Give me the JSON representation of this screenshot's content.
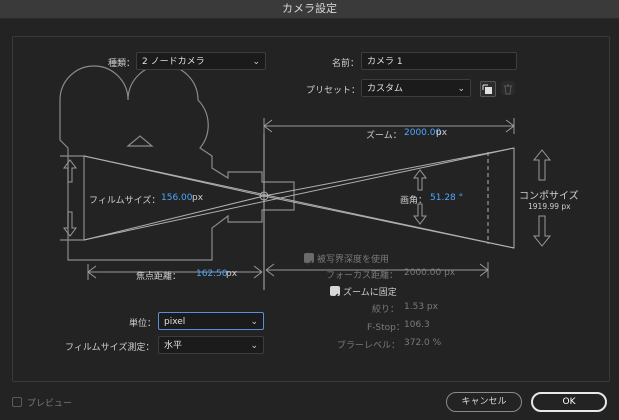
{
  "window": {
    "title": "カメラ設定"
  },
  "type": {
    "label": "種類：",
    "value": "2 ノードカメラ"
  },
  "name": {
    "label": "名前：",
    "value": "カメラ 1"
  },
  "preset": {
    "label": "プリセット：",
    "value": "カスタム"
  },
  "icons": {
    "save": "save-preset-icon",
    "delete": "trash-icon",
    "chevron": "chevron-down-icon",
    "checkmark": "checkmark-icon"
  },
  "zoom": {
    "label": "ズーム：",
    "value": "2000.00",
    "unit": "px"
  },
  "film_size": {
    "label": "フィルムサイズ：",
    "value": "156.00",
    "unit": "px"
  },
  "angle": {
    "label": "画角：",
    "value": "51.28 °"
  },
  "comp_size": {
    "label": "コンポサイズ",
    "value": "1919.99 px"
  },
  "focal_length": {
    "label": "焦点距離：",
    "value": "162.50",
    "unit": "px"
  },
  "dof": {
    "label": "被写界深度を使用",
    "checked": true,
    "enabled": false
  },
  "focus_distance": {
    "label": "フォーカス距離：",
    "value": "2000.00 px"
  },
  "lock_zoom": {
    "label": "ズームに固定",
    "checked": true
  },
  "aperture": {
    "label": "絞り：",
    "value": "1.53 px"
  },
  "fstop": {
    "label": "F-Stop：",
    "value": "106.3"
  },
  "blur_level": {
    "label": "ブラーレベル：",
    "value": "372.0 %"
  },
  "units": {
    "label": "単位：",
    "value": "pixel"
  },
  "measure": {
    "label": "フィルムサイズ測定：",
    "value": "水平"
  },
  "preview": {
    "label": "プレビュー",
    "checked": false
  },
  "buttons": {
    "cancel": "キャンセル",
    "ok": "OK"
  },
  "colors": {
    "accent": "#4ea6ff",
    "background": "#232323",
    "line": "#9a9a9a"
  }
}
